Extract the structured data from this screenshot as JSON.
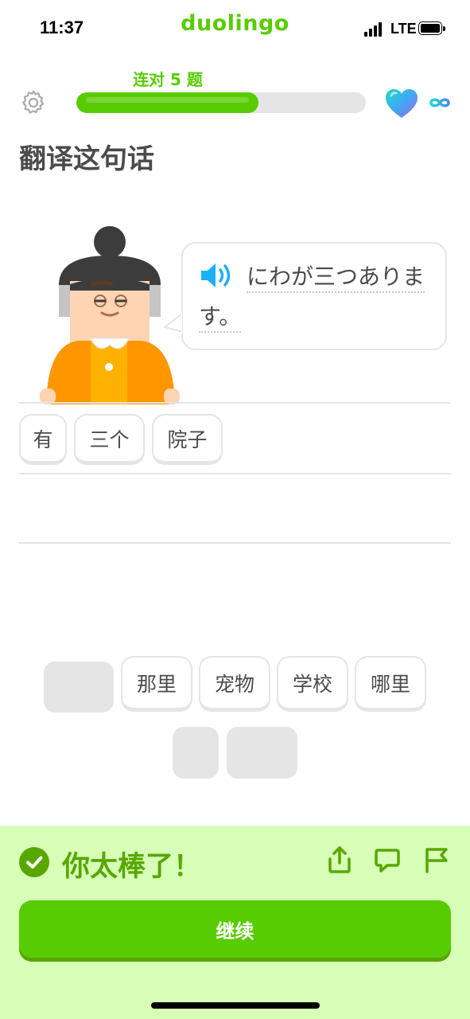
{
  "status_bar": {
    "time": "11:37",
    "app_name": "duolingo",
    "network": "LTE"
  },
  "header": {
    "streak_label": "连对 5 题",
    "progress_fraction": 0.63,
    "hearts": "∞",
    "settings_icon": "gear-icon",
    "heart_icon": "super-heart-icon",
    "infinity_icon": "infinity-icon"
  },
  "exercise": {
    "title": "翻译这句话",
    "prompt_line1": "にわが三つありま",
    "prompt_line2": "す。",
    "speaker_icon": "speaker-icon"
  },
  "answer_tiles": [
    "有",
    "三个",
    "院子"
  ],
  "word_bank": [
    "那里",
    "宠物",
    "学校",
    "哪里"
  ],
  "feedback": {
    "message": "你太棒了！",
    "check_icon": "check-circle-icon",
    "share_icon": "share-icon",
    "comment_icon": "comment-icon",
    "flag_icon": "flag-icon",
    "continue_label": "继续"
  },
  "colors": {
    "brand_green": "#58cc02",
    "dark_green": "#58a700",
    "feedback_bg": "#d7ffb8",
    "tile_border": "#e5e5e5",
    "speaker_blue": "#1cb0f6",
    "text": "#4b4b4b"
  }
}
